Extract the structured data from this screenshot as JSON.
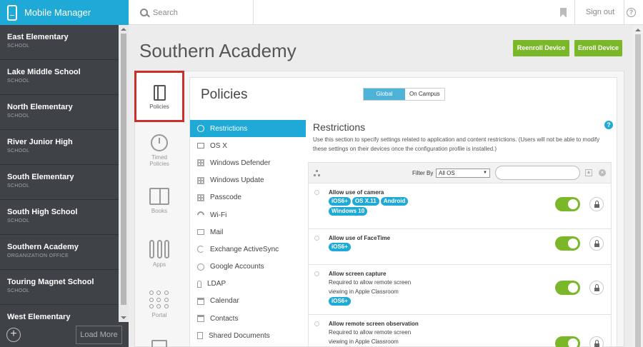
{
  "app": {
    "title": "Mobile Manager"
  },
  "topbar": {
    "search_label": "Search",
    "sign_out": "Sign out"
  },
  "sidebar": {
    "schools": [
      {
        "name": "East Elementary",
        "type": "SCHOOL"
      },
      {
        "name": "Lake Middle School",
        "type": "SCHOOL"
      },
      {
        "name": "North Elementary",
        "type": "SCHOOL"
      },
      {
        "name": "River Junior High",
        "type": "SCHOOL"
      },
      {
        "name": "South Elementary",
        "type": "SCHOOL"
      },
      {
        "name": "South High School",
        "type": "SCHOOL"
      },
      {
        "name": "Southern Academy",
        "type": "ORGANIZATION OFFICE"
      },
      {
        "name": "Touring Magnet School",
        "type": "SCHOOL"
      },
      {
        "name": "West Elementary",
        "type": ""
      }
    ],
    "load_more": "Load More"
  },
  "page": {
    "title": "Southern Academy",
    "reenroll_button": "Reenroll Device",
    "enroll_button": "Enroll Device"
  },
  "icon_tabs": {
    "policies": "Policies",
    "timed_1": "Timed",
    "timed_2": "Policies",
    "books": "Books",
    "apps": "Apps",
    "portal": "Portal"
  },
  "policies": {
    "title": "Policies",
    "scope_global": "Global",
    "scope_campus": "On Campus",
    "categories": [
      "Restrictions",
      "OS X",
      "Windows Defender",
      "Windows Update",
      "Passcode",
      "Wi-Fi",
      "Mail",
      "Exchange ActiveSync",
      "Google Accounts",
      "LDAP",
      "Calendar",
      "Contacts",
      "Shared Documents"
    ]
  },
  "restrictions": {
    "title": "Restrictions",
    "description": "Use this section to specify settings related to application and content restrictions. (Users will not be able to modify these settings on their devices once the configuration profile is installed.)",
    "filter_label": "Filter By",
    "filter_value": "All OS",
    "items": [
      {
        "title": "Allow use of camera",
        "desc1": "",
        "desc2": "",
        "tags": [
          "iOS6+",
          "OS X.11",
          "Android",
          "Windows 10"
        ]
      },
      {
        "title": "Allow use of FaceTime",
        "desc1": "",
        "desc2": "",
        "tags": [
          "iOS6+"
        ]
      },
      {
        "title": "Allow screen capture",
        "desc1": "Required to allow remote screen",
        "desc2": "viewing in Apple Classroom",
        "tags": [
          "iOS6+"
        ]
      },
      {
        "title": "Allow remote screen observation",
        "desc1": "Required to allow remote screen",
        "desc2": "viewing in Apple Classroom",
        "tags": []
      }
    ]
  },
  "colors": {
    "accent": "#1fa9d6",
    "green": "#7ab829",
    "sidebar": "#3f4347",
    "highlight": "#c9302c"
  }
}
